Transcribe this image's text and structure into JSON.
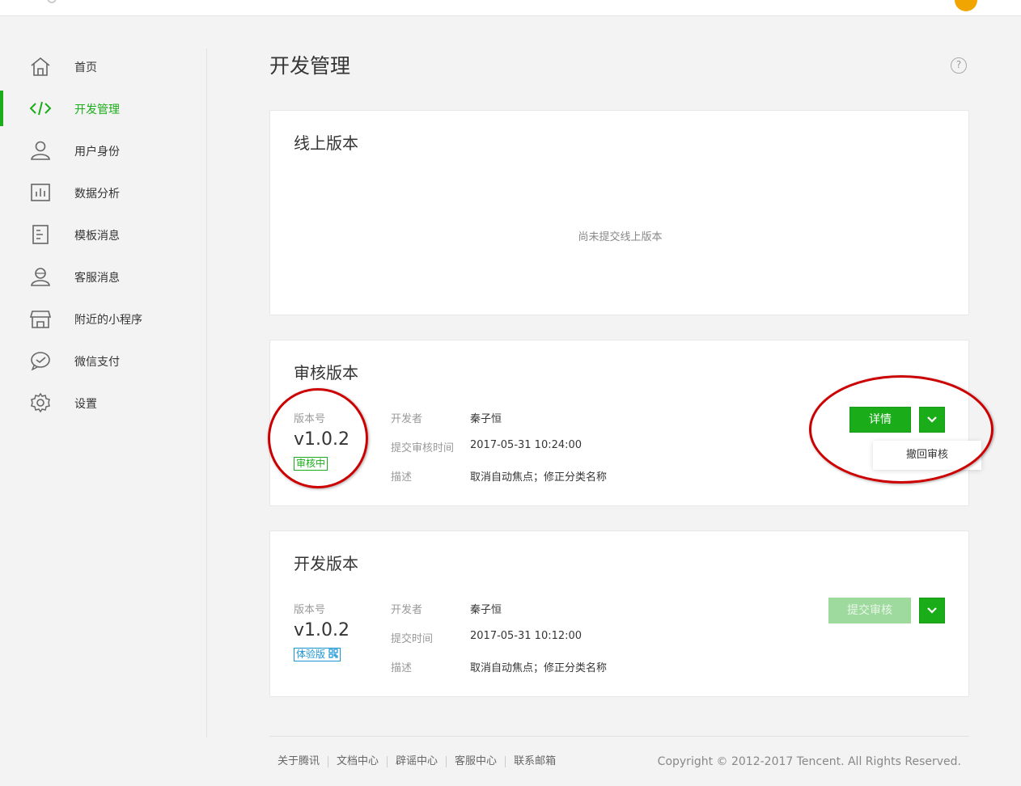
{
  "sidebar": {
    "items": [
      {
        "label": "首页",
        "icon": "home-icon"
      },
      {
        "label": "开发管理",
        "icon": "code-icon",
        "active": true
      },
      {
        "label": "用户身份",
        "icon": "user-icon"
      },
      {
        "label": "数据分析",
        "icon": "chart-icon"
      },
      {
        "label": "模板消息",
        "icon": "document-icon"
      },
      {
        "label": "客服消息",
        "icon": "customer-service-icon"
      },
      {
        "label": "附近的小程序",
        "icon": "store-icon"
      },
      {
        "label": "微信支付",
        "icon": "payment-icon"
      },
      {
        "label": "设置",
        "icon": "gear-icon"
      }
    ]
  },
  "page": {
    "title": "开发管理",
    "help": "?"
  },
  "online": {
    "title": "线上版本",
    "empty": "尚未提交线上版本"
  },
  "review": {
    "title": "审核版本",
    "version_label": "版本号",
    "version": "v1.0.2",
    "status": "审核中",
    "developer_key": "开发者",
    "developer": "秦子恒",
    "time_key": "提交审核时间",
    "time": "2017-05-31 10:24:00",
    "desc_key": "描述",
    "desc": "取消自动焦点；修正分类名称",
    "detail_btn": "详情",
    "menu_item": "撤回审核"
  },
  "dev": {
    "title": "开发版本",
    "version_label": "版本号",
    "version": "v1.0.2",
    "status": "体验版",
    "qr": "qr-code-icon",
    "developer_key": "开发者",
    "developer": "秦子恒",
    "time_key": "提交时间",
    "time": "2017-05-31 10:12:00",
    "desc_key": "描述",
    "desc": "取消自动焦点；修正分类名称",
    "submit_btn": "提交审核"
  },
  "footer": {
    "links": [
      "关于腾讯",
      "文档中心",
      "辟谣中心",
      "客服中心",
      "联系邮箱"
    ],
    "copyright": "Copyright © 2012-2017 Tencent. All Rights Reserved."
  },
  "colors": {
    "accent": "#1aad19",
    "annotation": "#cc0000",
    "badge_blue": "#1a95d4"
  }
}
